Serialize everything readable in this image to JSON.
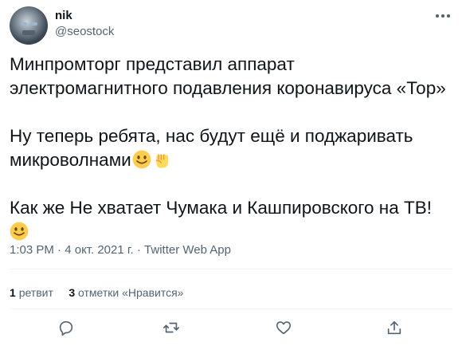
{
  "tweet": {
    "author_name": "nik",
    "author_handle": "@seostock",
    "paragraph1": "Минпромторг представил аппарат\nэлектромагнитного подавления коронавируса «Тор»",
    "paragraph2": "Ну теперь ребята, нас будут ещё и поджаривать\nмикроволнами",
    "paragraph3": "Как же Не хватает Чумака и Кашпировского на ТВ!",
    "time": "1:03 PM",
    "date": "4 окт. 2021 г.",
    "source": "Twitter Web App",
    "retweet_count": "1",
    "retweet_label": "ретвит",
    "like_count": "3",
    "like_label": "отметки «Нравится»"
  },
  "icons": {
    "more": "more-horizontal-icon",
    "reply": "reply-icon",
    "retweet": "retweet-icon",
    "like": "heart-icon",
    "share": "share-icon",
    "emoji1": "slightly-smiling-face-emoji",
    "emoji2": "raised-fist-emoji"
  },
  "colors": {
    "text": "#0f1419",
    "secondary": "#536471",
    "divider": "#eff3f4",
    "emoji_yellow": "#ffcc4d"
  }
}
